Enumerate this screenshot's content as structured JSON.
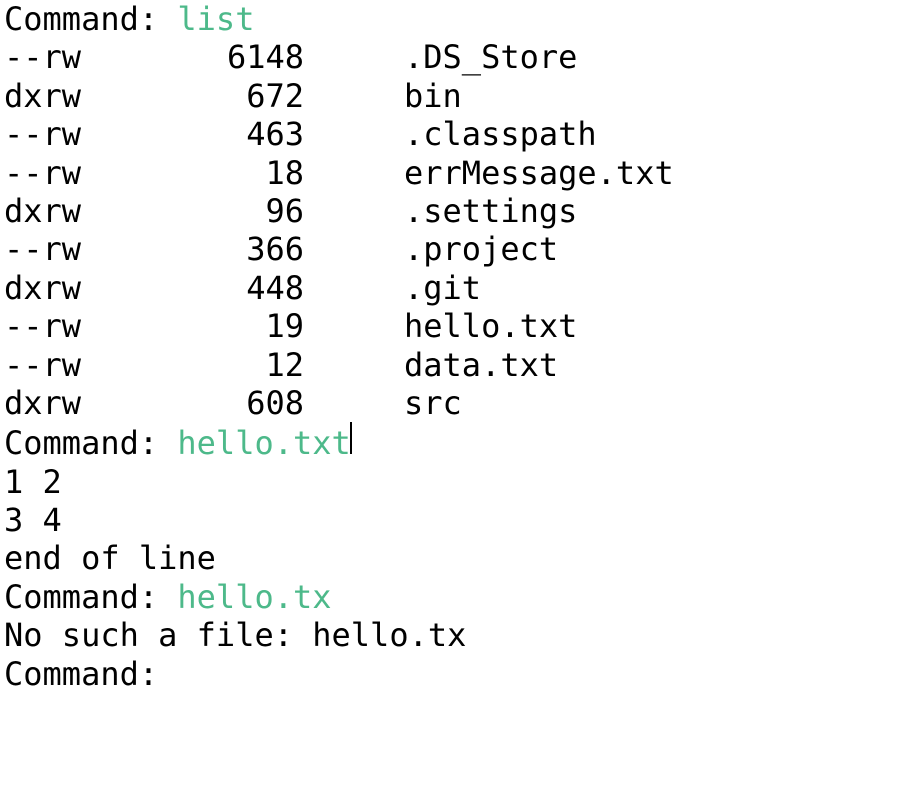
{
  "commands": {
    "cmd1_label": "Command: ",
    "cmd1_input": "list",
    "cmd2_label": "Command: ",
    "cmd2_input": "hello.txt",
    "cmd3_label": "Command: ",
    "cmd3_input": "hello.tx",
    "cmd4_label": "Command: "
  },
  "listing": [
    {
      "perms": "--rw",
      "size": "6148",
      "name": ".DS_Store"
    },
    {
      "perms": "dxrw",
      "size": "672",
      "name": "bin"
    },
    {
      "perms": "--rw",
      "size": "463",
      "name": ".classpath"
    },
    {
      "perms": "--rw",
      "size": "18",
      "name": "errMessage.txt"
    },
    {
      "perms": "dxrw",
      "size": "96",
      "name": ".settings"
    },
    {
      "perms": "--rw",
      "size": "366",
      "name": ".project"
    },
    {
      "perms": "dxrw",
      "size": "448",
      "name": ".git"
    },
    {
      "perms": "--rw",
      "size": "19",
      "name": "hello.txt"
    },
    {
      "perms": "--rw",
      "size": "12",
      "name": "data.txt"
    },
    {
      "perms": "dxrw",
      "size": "608",
      "name": "src"
    }
  ],
  "file_content": {
    "line1": "1 2",
    "line2": "3 4",
    "line3": "end of line"
  },
  "error_msg": "No such a file: hello.tx"
}
